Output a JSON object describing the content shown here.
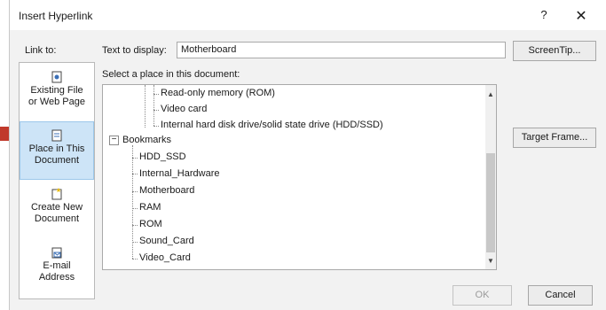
{
  "dialog": {
    "title": "Insert Hyperlink",
    "help_label": "?",
    "close_label": "✕"
  },
  "link_to": {
    "label": "Link to:",
    "items": [
      {
        "line1": "Existing File",
        "line2": "or Web Page",
        "icon": "file-icon"
      },
      {
        "line1": "Place in This",
        "line2": "Document",
        "icon": "document-icon"
      },
      {
        "line1": "Create New",
        "line2": "Document",
        "icon": "new-document-icon"
      },
      {
        "line1": "E-mail",
        "line2": "Address",
        "icon": "email-icon"
      }
    ],
    "selected_index": 1
  },
  "text_to_display": {
    "label": "Text to display:",
    "value": "Motherboard"
  },
  "screentip_label": "ScreenTip...",
  "place_section": {
    "label": "Select a place in this document:"
  },
  "tree": {
    "items": [
      "Read-only memory (ROM)",
      "Video card",
      "Internal hard disk drive/solid state drive (HDD/SSD)",
      "Bookmarks",
      "HDD_SSD",
      "Internal_Hardware",
      "Motherboard",
      "RAM",
      "ROM",
      "Sound_Card",
      "Video_Card"
    ],
    "collapse_symbol": "−"
  },
  "target_frame_label": "Target Frame...",
  "ok_label": "OK",
  "cancel_label": "Cancel",
  "colors": {
    "selected_bg": "#cde4f7",
    "arrow": "#c0392b"
  }
}
